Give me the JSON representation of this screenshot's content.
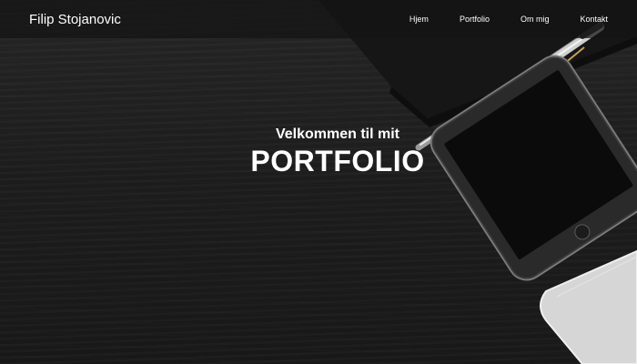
{
  "navbar": {
    "brand": "Filip Stojanovic",
    "links": [
      {
        "label": "Hjem"
      },
      {
        "label": "Portfolio"
      },
      {
        "label": "Om mig"
      },
      {
        "label": "Kontakt"
      }
    ]
  },
  "hero": {
    "subtitle": "Velkommen til mit",
    "title": "PORTFOLIO"
  },
  "colors": {
    "background": "#1e1e1e",
    "text": "#ffffff",
    "navbar": "#141414"
  }
}
